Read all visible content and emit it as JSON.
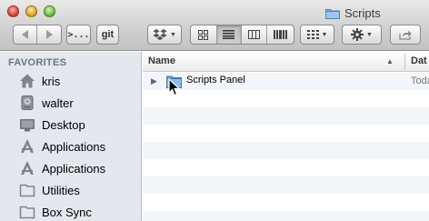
{
  "window": {
    "title": "Scripts",
    "folder_icon": "folder-icon"
  },
  "toolbar": {
    "back_icon": "back-arrow-icon",
    "forward_icon": "forward-arrow-icon",
    "terminal_label": ">...",
    "git_label": "git",
    "dropbox_icon": "dropbox-icon",
    "view_modes": [
      "icon-view",
      "list-view",
      "column-view",
      "coverflow-view"
    ],
    "active_view": "list-view",
    "arrange_icon": "arrange-icon",
    "action_icon": "gear-icon",
    "share_icon": "share-icon"
  },
  "sidebar": {
    "header": "FAVORITES",
    "items": [
      {
        "label": "kris",
        "icon": "home-icon"
      },
      {
        "label": "walter",
        "icon": "drive-icon"
      },
      {
        "label": "Desktop",
        "icon": "desktop-icon"
      },
      {
        "label": "Applications",
        "icon": "applications-icon"
      },
      {
        "label": "Applications",
        "icon": "applications-icon"
      },
      {
        "label": "Utilities",
        "icon": "folder-icon"
      },
      {
        "label": "Box Sync",
        "icon": "folder-icon"
      }
    ]
  },
  "list": {
    "columns": {
      "name": "Name",
      "date": "Dat"
    },
    "rows": [
      {
        "name": "Scripts Panel",
        "date": "Toda"
      }
    ]
  },
  "colors": {
    "sidebar_bg": "#e4e8ee",
    "sidebar_header": "#6e747c",
    "folder_blue": "#7fb4e6",
    "row_alt": "#f2f5fa"
  }
}
